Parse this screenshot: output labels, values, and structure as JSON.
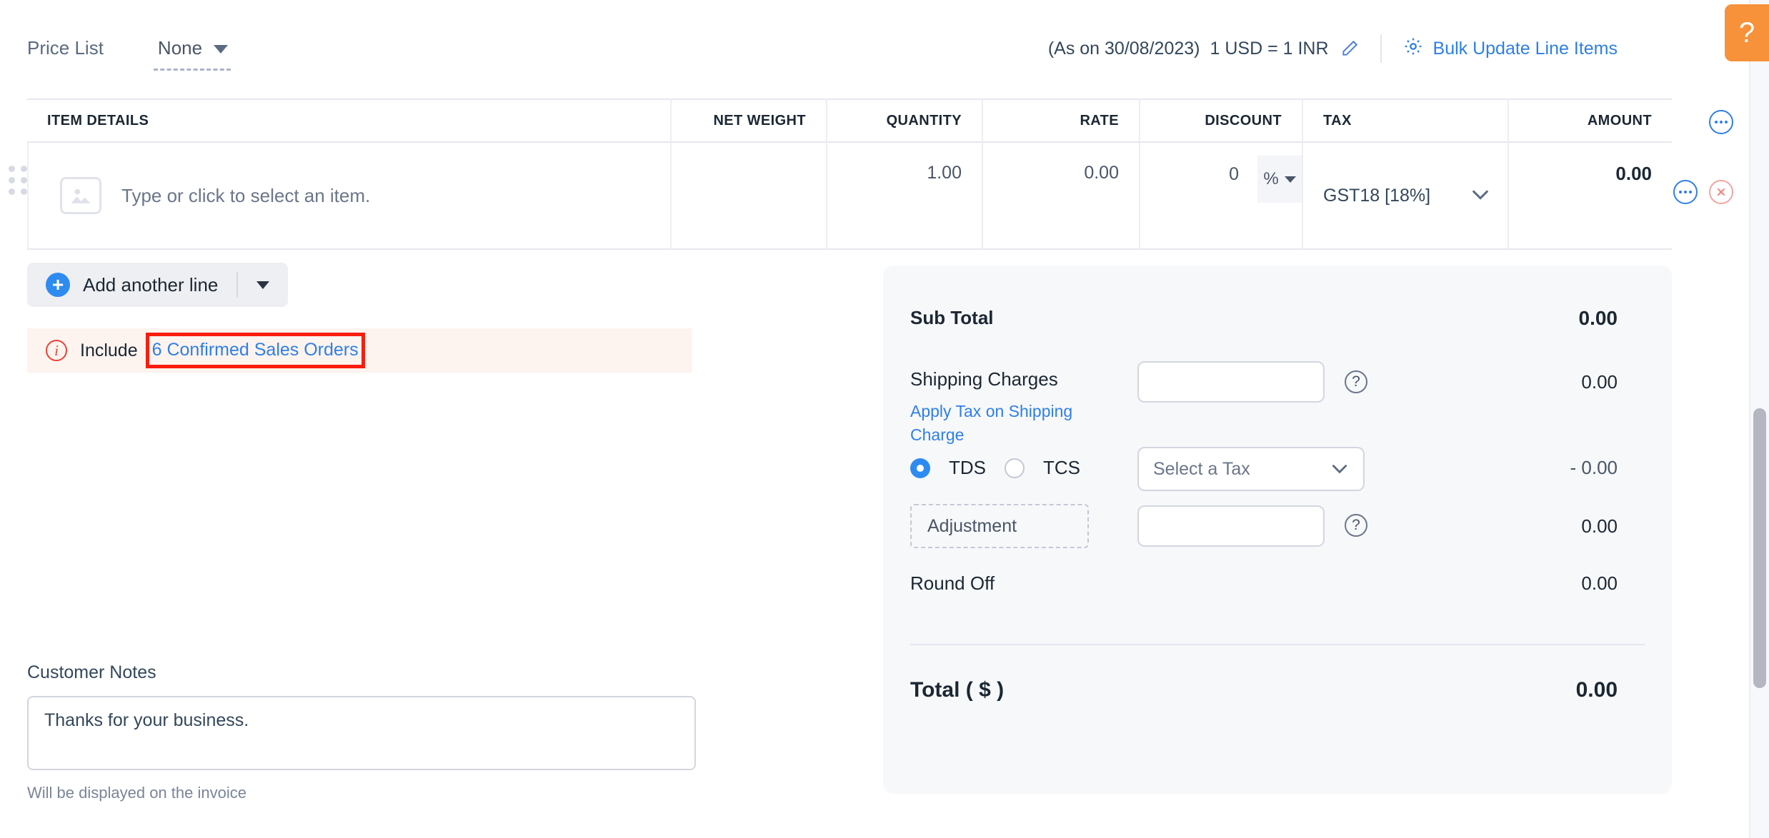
{
  "topbar": {
    "price_list_label": "Price List",
    "price_list_value": "None",
    "exchange_as_on": "(As on 30/08/2023)",
    "exchange_rate": "1 USD = 1 INR",
    "edit_icon": "pencil-icon",
    "bulk_update_label": "Bulk Update Line Items",
    "bulk_update_icon": "gear-icon"
  },
  "items_table": {
    "headers": {
      "item_details": "ITEM DETAILS",
      "net_weight": "NET WEIGHT",
      "quantity": "QUANTITY",
      "rate": "RATE",
      "discount": "DISCOUNT",
      "tax": "TAX",
      "amount": "AMOUNT"
    },
    "rows": [
      {
        "item_placeholder": "Type or click to select an item.",
        "net_weight": "",
        "quantity": "1.00",
        "rate": "0.00",
        "discount": "0",
        "discount_unit": "%",
        "tax": "GST18 [18%]",
        "amount": "0.00"
      }
    ]
  },
  "add_line": {
    "label": "Add another line",
    "plus_icon": "plus-circle-icon",
    "caret_icon": "caret-down-icon"
  },
  "banner": {
    "icon": "info-circle-icon",
    "text": "Include",
    "link": "6 Confirmed Sales Orders"
  },
  "customer_notes": {
    "label": "Customer Notes",
    "value": "Thanks for your business.",
    "hint": "Will be displayed on the invoice"
  },
  "totals": {
    "sub_total_label": "Sub Total",
    "sub_total_value": "0.00",
    "shipping_label": "Shipping Charges",
    "shipping_input": "",
    "shipping_value": "0.00",
    "apply_tax_link": "Apply Tax on Shipping Charge",
    "tds_label": "TDS",
    "tcs_label": "TCS",
    "tax_select_value": "Select a Tax",
    "tds_value": "- 0.00",
    "adjustment_label": "Adjustment",
    "adjustment_input": "",
    "adjustment_value": "0.00",
    "round_off_label": "Round Off",
    "round_off_value": "0.00",
    "total_label": "Total ( $ )",
    "total_value": "0.00",
    "help_icon": "question-circle-icon"
  },
  "help_fab": {
    "label": "?"
  },
  "colors": {
    "link_blue": "#2e7fe8",
    "accent_blue": "#2e8bf0",
    "help_orange": "#f7913a",
    "banner_bg": "#fdf3ef",
    "highlight_red": "#f91d0e",
    "panel_bg": "#f7f8fa"
  }
}
